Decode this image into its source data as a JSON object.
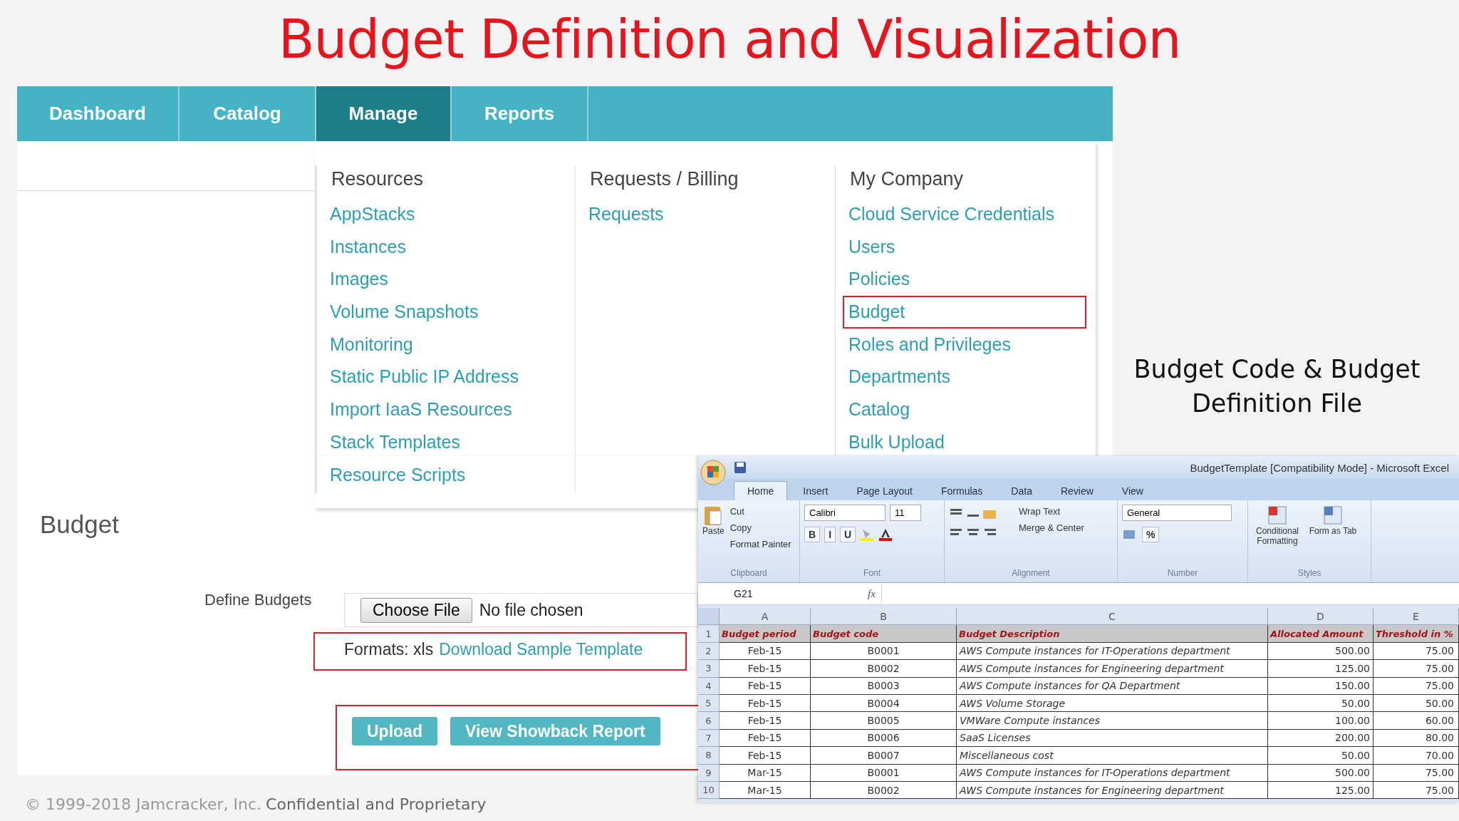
{
  "title": "Budget Definition and Visualization",
  "nav": {
    "tabs": [
      {
        "label": "Dashboard",
        "selected": false
      },
      {
        "label": "Catalog",
        "selected": false
      },
      {
        "label": "Manage",
        "selected": true
      },
      {
        "label": "Reports",
        "selected": false
      }
    ]
  },
  "menu": {
    "columns": [
      {
        "heading": "Resources",
        "items": [
          {
            "label": "AppStacks",
            "selected": false
          },
          {
            "label": "Instances",
            "selected": false
          },
          {
            "label": "Images",
            "selected": false
          },
          {
            "label": "Volume Snapshots",
            "selected": false
          },
          {
            "label": "Monitoring",
            "selected": false
          },
          {
            "label": "Static Public IP Address",
            "selected": false
          },
          {
            "label": "Import IaaS Resources",
            "selected": false
          },
          {
            "label": "Stack Templates",
            "selected": false
          },
          {
            "label": "Resource Scripts",
            "selected": false
          }
        ]
      },
      {
        "heading": "Requests / Billing",
        "items": [
          {
            "label": "Requests",
            "selected": false
          }
        ]
      },
      {
        "heading": "My Company",
        "items": [
          {
            "label": "Cloud Service Credentials",
            "selected": false
          },
          {
            "label": "Users",
            "selected": false
          },
          {
            "label": "Policies",
            "selected": false
          },
          {
            "label": "Budget",
            "selected": true
          },
          {
            "label": "Roles and Privileges",
            "selected": false
          },
          {
            "label": "Departments",
            "selected": false
          },
          {
            "label": "Catalog",
            "selected": false
          },
          {
            "label": "Bulk Upload",
            "selected": false
          }
        ]
      }
    ]
  },
  "side_note": "Budget Code & Budget Definition File",
  "form": {
    "heading": "Budget",
    "field_label": "Define Budgets",
    "file_button": "Choose File",
    "file_status": "No file chosen",
    "formats": "Formats: xls",
    "template_link": "Download Sample Template",
    "buttons": [
      "Upload",
      "View Showback Report"
    ]
  },
  "excel": {
    "title": "BudgetTemplate  [Compatibility Mode] - Microsoft Excel",
    "tabs": [
      {
        "label": "Home",
        "selected": true
      },
      {
        "label": "Insert",
        "selected": false
      },
      {
        "label": "Page Layout",
        "selected": false
      },
      {
        "label": "Formulas",
        "selected": false
      },
      {
        "label": "Data",
        "selected": false
      },
      {
        "label": "Review",
        "selected": false
      },
      {
        "label": "View",
        "selected": false
      }
    ],
    "clipboard": {
      "paste": "Paste",
      "items": [
        "Cut",
        "Copy",
        "Format Painter"
      ],
      "group": "Clipboard"
    },
    "font": {
      "name": "Calibri",
      "size": "11",
      "styles": [
        "B",
        "I",
        "U"
      ],
      "group": "Font"
    },
    "alignment": {
      "items": [
        "Wrap Text",
        "Merge & Center"
      ],
      "group": "Alignment"
    },
    "number": {
      "format": "General",
      "items": [
        "%"
      ],
      "group": "Number"
    },
    "styles": {
      "items": [
        "Conditional Formatting",
        "Form as Tab"
      ],
      "group": "Styles"
    },
    "name_box": "G21",
    "fx": "fx",
    "columns": [
      "A",
      "B",
      "C",
      "D",
      "E"
    ],
    "header": {
      "row": "1",
      "cells": [
        "Budget period",
        "Budget code",
        "Budget Description",
        "Allocated Amount",
        "Threshold  in %"
      ]
    },
    "rows": [
      {
        "row": "2",
        "cells": [
          "Feb-15",
          "B0001",
          "AWS Compute instances for IT-Operations department",
          "500.00",
          "75.00"
        ]
      },
      {
        "row": "3",
        "cells": [
          "Feb-15",
          "B0002",
          "AWS Compute instances for Engineering department",
          "125.00",
          "75.00"
        ]
      },
      {
        "row": "4",
        "cells": [
          "Feb-15",
          "B0003",
          "AWS Compute instances for QA Department",
          "150.00",
          "75.00"
        ]
      },
      {
        "row": "5",
        "cells": [
          "Feb-15",
          "B0004",
          "AWS Volume Storage",
          "50.00",
          "50.00"
        ]
      },
      {
        "row": "6",
        "cells": [
          "Feb-15",
          "B0005",
          "VMWare Compute instances",
          "100.00",
          "60.00"
        ]
      },
      {
        "row": "7",
        "cells": [
          "Feb-15",
          "B0006",
          "SaaS Licenses",
          "200.00",
          "80.00"
        ]
      },
      {
        "row": "8",
        "cells": [
          "Feb-15",
          "B0007",
          "Miscellaneous cost",
          "50.00",
          "70.00"
        ]
      },
      {
        "row": "9",
        "cells": [
          "Mar-15",
          "B0001",
          "AWS Compute instances for IT-Operations department",
          "500.00",
          "75.00"
        ]
      },
      {
        "row": "10",
        "cells": [
          "Mar-15",
          "B0002",
          "AWS Compute instances for Engineering department",
          "125.00",
          "75.00"
        ]
      }
    ]
  },
  "footer": {
    "copyright": "© 1999-2018 Jamcracker, Inc.",
    "note": "Confidential and Proprietary"
  }
}
